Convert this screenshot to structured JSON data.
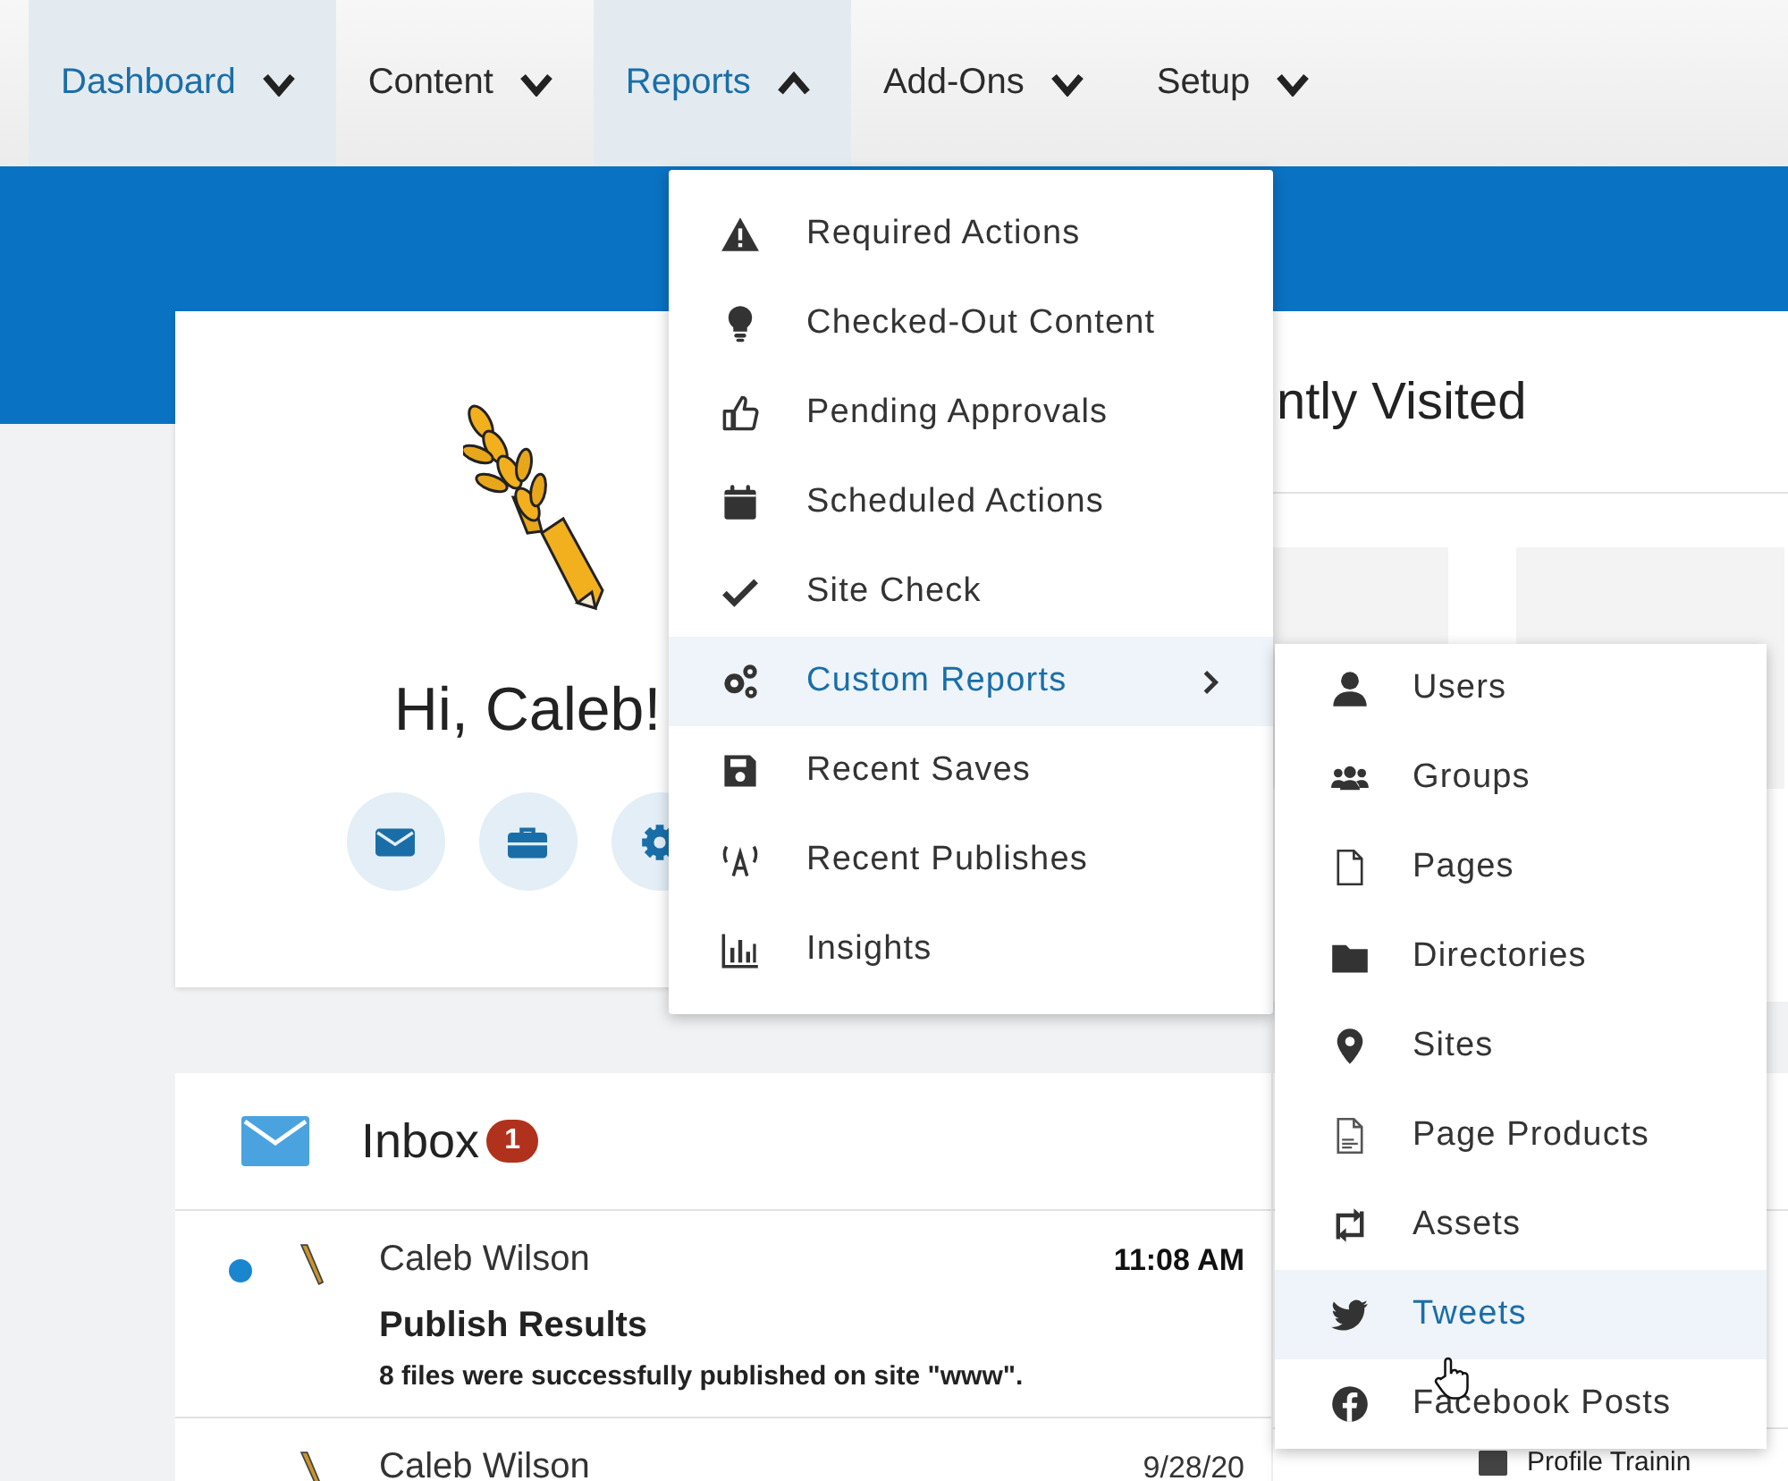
{
  "nav": {
    "items": [
      {
        "label": "Dashboard",
        "selected": true,
        "expanded": false
      },
      {
        "label": "Content",
        "selected": false,
        "expanded": false
      },
      {
        "label": "Reports",
        "selected": true,
        "expanded": true
      },
      {
        "label": "Add-Ons",
        "selected": false,
        "expanded": false
      },
      {
        "label": "Setup",
        "selected": false,
        "expanded": false
      }
    ]
  },
  "greeting": {
    "text": "Hi, Caleb!"
  },
  "recently_visited": {
    "title": "ntly Visited"
  },
  "inbox": {
    "title": "Inbox",
    "badge": "1",
    "messages": [
      {
        "sender": "Caleb Wilson",
        "time": "11:08 AM",
        "subject": "Publish Results",
        "body": "8 files were successfully published on site \"www\".",
        "unread": true
      },
      {
        "sender": "Caleb Wilson",
        "time": "9/28/20",
        "unread": false
      }
    ]
  },
  "side_panel": {
    "items": [
      {
        "label": "Profile Trainin"
      }
    ]
  },
  "reports_menu": {
    "items": [
      {
        "label": "Required Actions",
        "selected": false,
        "has_submenu": false
      },
      {
        "label": "Checked-Out Content",
        "selected": false,
        "has_submenu": false
      },
      {
        "label": "Pending Approvals",
        "selected": false,
        "has_submenu": false
      },
      {
        "label": "Scheduled Actions",
        "selected": false,
        "has_submenu": false
      },
      {
        "label": "Site Check",
        "selected": false,
        "has_submenu": false
      },
      {
        "label": "Custom Reports",
        "selected": true,
        "has_submenu": true
      },
      {
        "label": "Recent Saves",
        "selected": false,
        "has_submenu": false
      },
      {
        "label": "Recent Publishes",
        "selected": false,
        "has_submenu": false
      },
      {
        "label": "Insights",
        "selected": false,
        "has_submenu": false
      }
    ]
  },
  "custom_reports_submenu": {
    "items": [
      {
        "label": "Users",
        "selected": false
      },
      {
        "label": "Groups",
        "selected": false
      },
      {
        "label": "Pages",
        "selected": false
      },
      {
        "label": "Directories",
        "selected": false
      },
      {
        "label": "Sites",
        "selected": false
      },
      {
        "label": "Page Products",
        "selected": false
      },
      {
        "label": "Assets",
        "selected": false
      },
      {
        "label": "Tweets",
        "selected": true
      },
      {
        "label": "Facebook Posts",
        "selected": false
      }
    ]
  }
}
